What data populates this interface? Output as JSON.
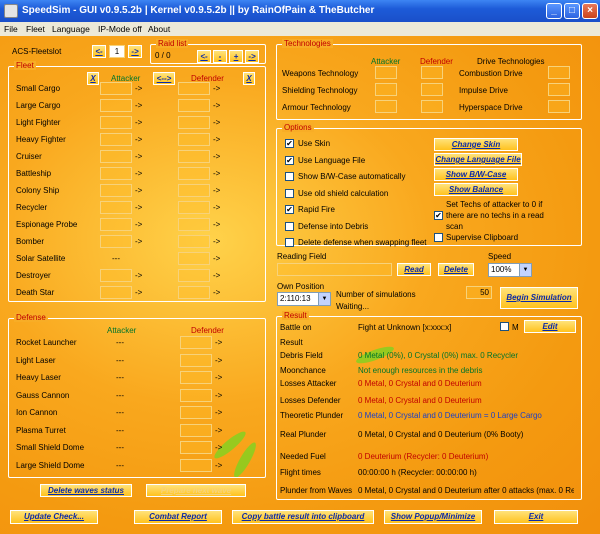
{
  "window": {
    "title": "SpeedSim - GUI v0.9.5.2b | Kernel v0.9.5.2b  ||  by RainOfPain & TheButcher",
    "min": "_",
    "max": "□",
    "close": "×"
  },
  "menu": [
    "File",
    "Fleet",
    "Language",
    "IP-Mode off",
    "About"
  ],
  "acs": {
    "label": "ACS-Fleetslot",
    "value": "1",
    "prev": "<-",
    "next": "->"
  },
  "raid": {
    "legend": "Raid list",
    "value": "0 / 0",
    "btn_prev": "<-",
    "btn_minus": "-",
    "btn_plus": "+",
    "btn_next": "->"
  },
  "fleet": {
    "legend": "Fleet",
    "clear_att": "X",
    "attacker": "Attacker",
    "swap": "<-->",
    "defender": "Defender",
    "clear_def": "X",
    "arrow": "->",
    "ships": [
      "Small Cargo",
      "Large Cargo",
      "Light Fighter",
      "Heavy Fighter",
      "Cruiser",
      "Battleship",
      "Colony Ship",
      "Recycler",
      "Espionage Probe",
      "Bomber",
      "Solar Satellite",
      "Destroyer",
      "Death Star"
    ],
    "sat_att": "---"
  },
  "defense": {
    "legend": "Defense",
    "attacker": "Attacker",
    "defender": "Defender",
    "dash": "---",
    "arrow": "->",
    "items": [
      "Rocket Launcher",
      "Light Laser",
      "Heavy Laser",
      "Gauss Cannon",
      "Ion Cannon",
      "Plasma Turret",
      "Small Shield Dome",
      "Large Shield Dome"
    ]
  },
  "bottom_left": {
    "delete_waves": "Delete waves status",
    "prepare": "Prepare next wave"
  },
  "tech": {
    "legend": "Technologies",
    "attacker": "Attacker",
    "defender": "Defender",
    "drive": "Drive Technologies",
    "rows": [
      "Weapons Technology",
      "Shielding Technology",
      "Armour Technology"
    ],
    "drives": [
      "Combustion Drive",
      "Impulse Drive",
      "Hyperspace Drive"
    ]
  },
  "options": {
    "legend": "Options",
    "items": [
      {
        "label": "Use Skin",
        "checked": "✔"
      },
      {
        "label": "Use Language File",
        "checked": "✔"
      },
      {
        "label": "Show B/W-Case automatically",
        "checked": ""
      },
      {
        "label": "Use old shield calculation",
        "checked": ""
      },
      {
        "label": "Rapid Fire",
        "checked": "✔"
      },
      {
        "label": "Defense into Debris",
        "checked": ""
      },
      {
        "label": "Delete defense when swapping fleet",
        "checked": ""
      }
    ],
    "btns": [
      "Change Skin",
      "Change Language File",
      "Show B/W-Case",
      "Show Balance"
    ],
    "set_techs_1": "Set Techs of attacker to 0 if",
    "set_techs_2": "there are no techs in a read",
    "set_techs_3": "scan",
    "set_techs_checked": "✔",
    "supervise": "Supervise Clipboard"
  },
  "reading": {
    "label": "Reading Field",
    "read": "Read",
    "delete": "Delete"
  },
  "speed": {
    "label": "Speed",
    "value": "100%"
  },
  "own": {
    "label": "Own Position",
    "value": "2:110:13",
    "sims_label": "Number of simulations",
    "sims": "50",
    "waiting": "Waiting...",
    "begin": "Begin Simulation"
  },
  "result": {
    "legend": "Result",
    "battle_on": "Battle on",
    "fight": "Fight at Unknown [x:xxx:x]",
    "m": "M",
    "edit": "Edit",
    "result": "Result",
    "rows": [
      {
        "k": "Debris Field",
        "v": "0 Metal (0%), 0 Crystal (0%) max. 0 Recycler",
        "c": "grn"
      },
      {
        "k": "Moonchance",
        "v": "Not enough resources in the debris",
        "c": "grn"
      },
      {
        "k": "Losses Attacker",
        "v": "0 Metal, 0 Crystal and 0 Deuterium",
        "c": "red"
      },
      {
        "k": "Losses Defender",
        "v": "0 Metal, 0 Crystal and 0 Deuterium",
        "c": "red"
      },
      {
        "k": "Theoretic Plunder",
        "v": "0 Metal, 0 Crystal and 0 Deuterium = 0 Large Cargo",
        "c": "blu"
      },
      {
        "k": "Real Plunder",
        "v": "0 Metal, 0 Crystal and 0 Deuterium (0% Booty)",
        "c": ""
      },
      {
        "k": "Needed Fuel",
        "v": "0 Deuterium (Recycler: 0 Deuterium)",
        "c": "red"
      },
      {
        "k": "Flight times",
        "v": "00:00:00 h (Recycler: 00:00:00 h)",
        "c": ""
      },
      {
        "k": "Plunder from Waves",
        "v": "0 Metal, 0 Crystal and 0 Deuterium after 0 attacks (max. 0 Re",
        "c": ""
      }
    ]
  },
  "footer": [
    "Update Check...",
    "Combat Report",
    "Copy battle result into clipboard",
    "Show Popup/Minimize",
    "Exit"
  ],
  "colors": {
    "accent": "#f49a10",
    "legend": "#c00000",
    "button_text": "#0b2aa8"
  }
}
